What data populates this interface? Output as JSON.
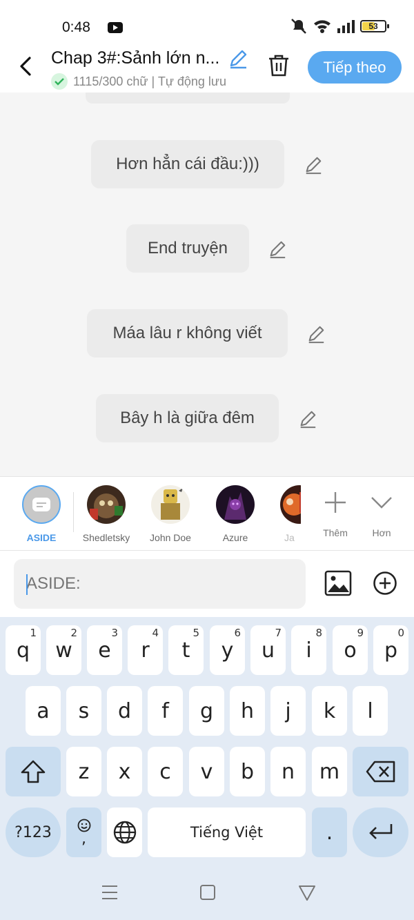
{
  "status_bar": {
    "time": "0:48",
    "battery": "53"
  },
  "header": {
    "title": "Chap 3#:Sảnh lớn n...",
    "subtitle": "1115/300 chữ | Tự động lưu",
    "next_label": "Tiếp theo"
  },
  "messages": [
    {
      "text": "Hơn hẳn cái đầu:)))"
    },
    {
      "text": "End truyện"
    },
    {
      "text": "Máa lâu r không viết"
    },
    {
      "text": "Bây h là giữa đêm"
    }
  ],
  "characters": [
    {
      "name": "ASIDE",
      "selected": true
    },
    {
      "name": "Shedletsky"
    },
    {
      "name": "John Doe"
    },
    {
      "name": "Azure"
    },
    {
      "name": "Ja"
    }
  ],
  "tools": {
    "more_label": "Thêm",
    "collapse_label": "Hơn"
  },
  "input": {
    "placeholder": "ASIDE:"
  },
  "keyboard": {
    "row1": [
      {
        "k": "q",
        "h": "1"
      },
      {
        "k": "w",
        "h": "2"
      },
      {
        "k": "e",
        "h": "3"
      },
      {
        "k": "r",
        "h": "4"
      },
      {
        "k": "t",
        "h": "5"
      },
      {
        "k": "y",
        "h": "6"
      },
      {
        "k": "u",
        "h": "7"
      },
      {
        "k": "i",
        "h": "8"
      },
      {
        "k": "o",
        "h": "9"
      },
      {
        "k": "p",
        "h": "0"
      }
    ],
    "row2": [
      "a",
      "s",
      "d",
      "f",
      "g",
      "h",
      "j",
      "k",
      "l"
    ],
    "row3": [
      "z",
      "x",
      "c",
      "v",
      "b",
      "n",
      "m"
    ],
    "symbols_label": "?123",
    "space_label": "Tiếng Việt",
    "period_label": ".",
    "comma_label": ","
  },
  "colors": {
    "accent": "#5aa9f0",
    "aside_name": "#4a98e8",
    "bubble": "#ebebeb",
    "keyboard_bg": "#e3ebf5"
  }
}
